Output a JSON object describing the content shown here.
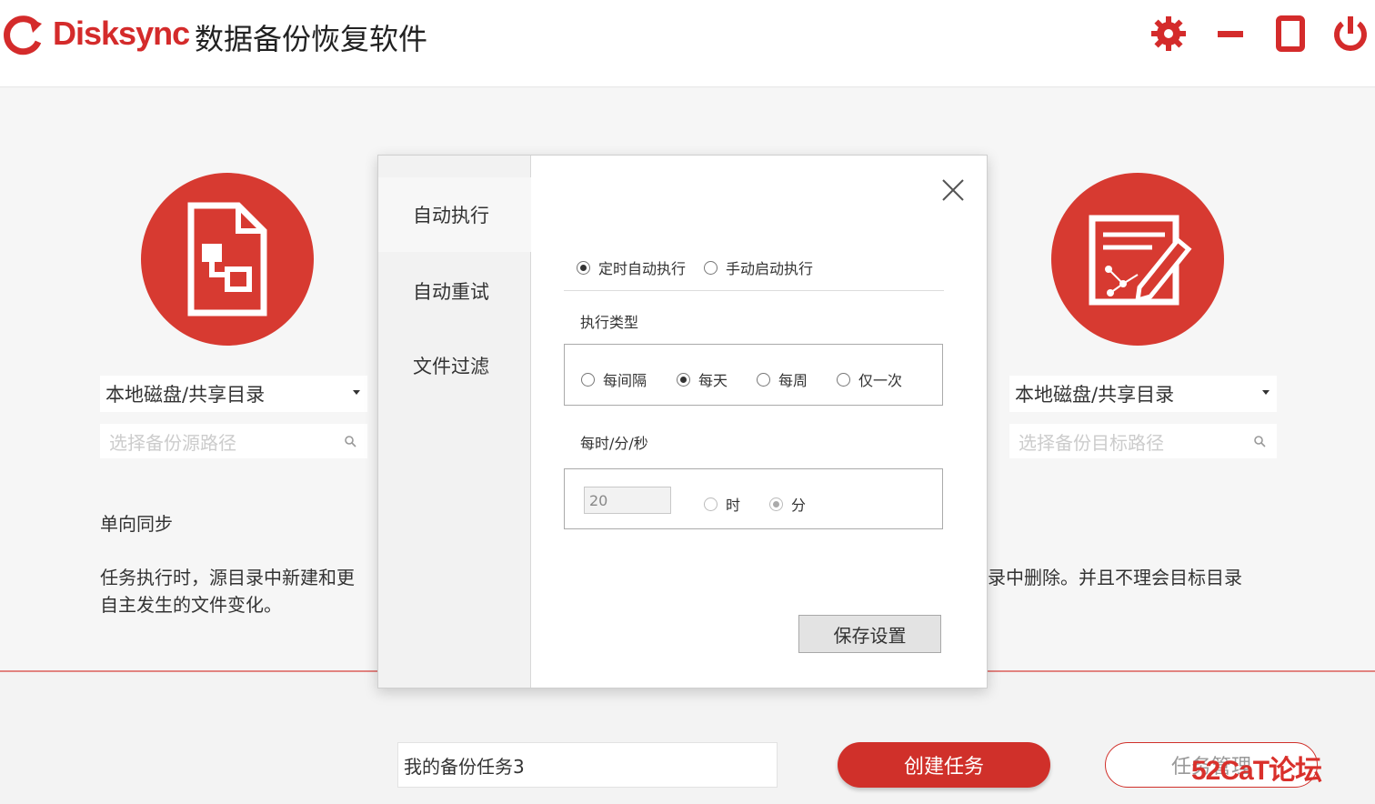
{
  "header": {
    "brand": "Disksync",
    "title": "数据备份恢复软件"
  },
  "source": {
    "select_value": "本地磁盘/共享目录",
    "path_placeholder": "选择备份源路径"
  },
  "target": {
    "select_value": "本地磁盘/共享目录",
    "path_placeholder": "选择备份目标路径"
  },
  "description": {
    "title": "单向同步",
    "line1_left": "任务执行时，源目录中新建和更",
    "line2_left": "自主发生的文件变化。",
    "line1_right": "录中删除。并且不理会目标目录"
  },
  "dialog": {
    "tabs": [
      "自动执行",
      "自动重试",
      "文件过滤"
    ],
    "mode_options": [
      "定时自动执行",
      "手动启动执行"
    ],
    "mode_selected": "定时自动执行",
    "exec_type_label": "执行类型",
    "exec_type_options": [
      "每间隔",
      "每天",
      "每周",
      "仅一次"
    ],
    "exec_type_selected": "每天",
    "time_label": "每时/分/秒",
    "time_value": "20",
    "time_units": [
      "时",
      "分"
    ],
    "time_unit_selected": "分",
    "save_label": "保存设置"
  },
  "bottom": {
    "task_name": "我的备份任务3",
    "create_label": "创建任务",
    "manage_label": "任务管理",
    "watermark": "52CaT论坛"
  },
  "colors": {
    "accent": "#d0302a"
  }
}
